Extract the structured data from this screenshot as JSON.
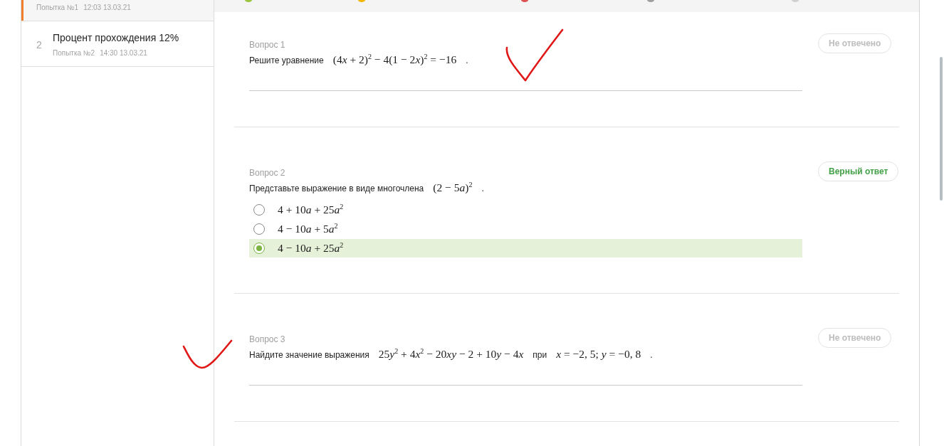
{
  "sidebar": {
    "attempts": [
      {
        "attempt": "Попытка №1",
        "time": "12:03 13.03.21",
        "selected": true
      },
      {
        "number": "2",
        "title": "Процент прохождения 12%",
        "attempt": "Попытка №2",
        "time": "14:30 13.03.21",
        "selected": false
      }
    ]
  },
  "progress_markers": [
    {
      "color": "#9bc53d"
    },
    {
      "color": "#f2b705"
    },
    {
      "color": "#dc5050"
    },
    {
      "color": "#9e9e9e"
    },
    {
      "color": "#cfcfcf"
    }
  ],
  "questions": [
    {
      "label": "Вопрос 1",
      "kind": "input",
      "prompt": [
        {
          "kind": "text",
          "text": "Решите уравнение"
        },
        {
          "kind": "math",
          "text": "(4x + 2)$^{2}$ − 4(1 − 2x)$^{2}$ = −16"
        },
        {
          "kind": "text",
          "text": "."
        }
      ],
      "status": {
        "kind": "unanswered",
        "label": "Не отвечено"
      }
    },
    {
      "label": "Вопрос 2",
      "kind": "choice",
      "prompt": [
        {
          "kind": "text",
          "text": "Представьте выражение в виде многочлена"
        },
        {
          "kind": "math",
          "text": "(2 − 5a)$^{2}$"
        },
        {
          "kind": "text",
          "text": "."
        }
      ],
      "options": [
        {
          "text": "4 + 10a + 25a$^{2}$",
          "selected": false
        },
        {
          "text": "4 − 10a + 5a$^{2}$",
          "selected": false
        },
        {
          "text": "4 − 10a + 25a$^{2}$",
          "selected": true
        }
      ],
      "status": {
        "kind": "correct",
        "label": "Верный ответ"
      }
    },
    {
      "label": "Вопрос 3",
      "kind": "input",
      "prompt": [
        {
          "kind": "text",
          "text": "Найдите значение выражения"
        },
        {
          "kind": "math",
          "text": "25y$^{2}$ + 4x$^{2}$ − 20xy − 2 + 10y − 4x"
        },
        {
          "kind": "text",
          "text": "при"
        },
        {
          "kind": "math",
          "text": "x = −2, 5; y = −0, 8"
        },
        {
          "kind": "text",
          "text": "."
        }
      ],
      "status": {
        "kind": "unanswered",
        "label": "Не отвечено"
      }
    }
  ]
}
